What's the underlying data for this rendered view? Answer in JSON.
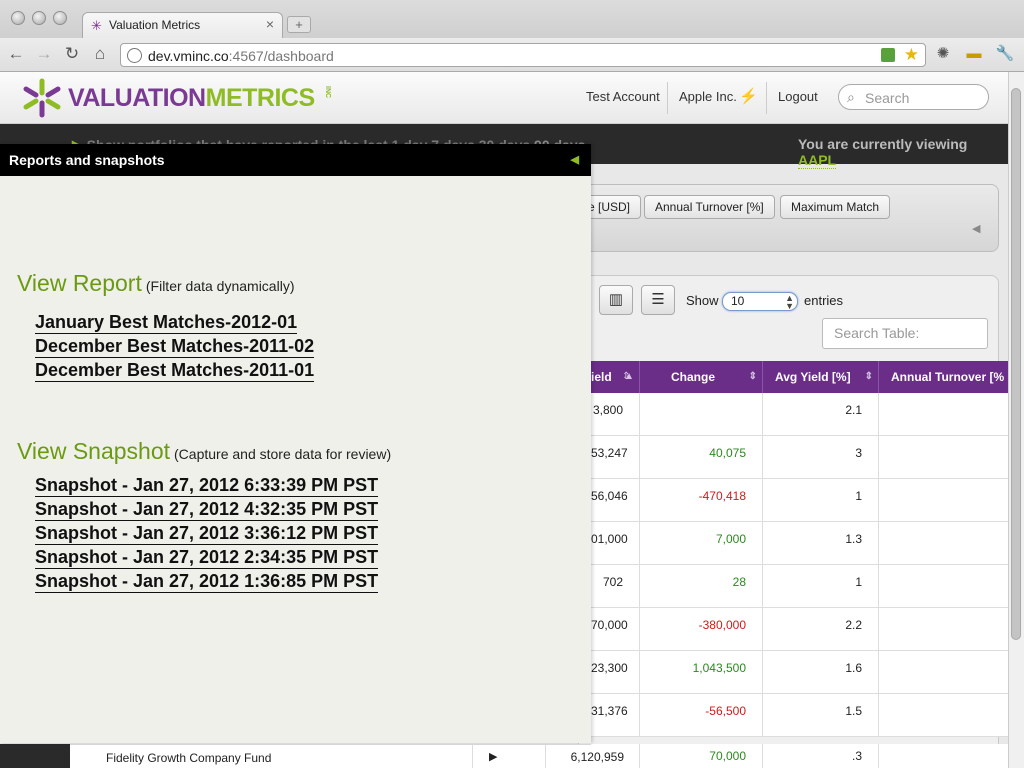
{
  "browser": {
    "tab_title": "Valuation Metrics",
    "url_host": "dev.vminc.co",
    "url_rest": ":4567/dashboard",
    "new_tab": "+",
    "close_tab": "×"
  },
  "header": {
    "logo_valuation": "VALUATION",
    "logo_metrics": "METRICS",
    "logo_inc": "INC",
    "nav": [
      "Test Account",
      "Apple Inc.",
      "Logout"
    ],
    "search_placeholder": "Search"
  },
  "filter_bar": {
    "prefix": "Show portfolios that have reported in the last",
    "options": [
      "1 day",
      "7 days",
      "30 days",
      "90 days"
    ],
    "viewing_text": "You are currently viewing",
    "ticker": "AAPL"
  },
  "columns_filter": {
    "pills": [
      "e [USD]",
      "Annual Turnover [%]",
      "Maximum Match"
    ]
  },
  "table_controls": {
    "show_label": "Show",
    "show_value": "10",
    "entries_label": "entries",
    "search_placeholder": "Search Table:"
  },
  "table": {
    "headers": [
      "ield",
      "Change",
      "Avg Yield [%]",
      "Annual Turnover [%"
    ],
    "rows": [
      {
        "yield": "3,800",
        "change": "",
        "avg": "2.1",
        "turnover": ""
      },
      {
        "yield": "53,247",
        "change": "40,075",
        "avg": "3",
        "turnover": ""
      },
      {
        "yield": "56,046",
        "change": "-470,418",
        "avg": "1",
        "turnover": ""
      },
      {
        "yield": "01,000",
        "change": "7,000",
        "avg": "1.3",
        "turnover": ""
      },
      {
        "yield": "702",
        "change": "28",
        "avg": "1",
        "turnover": ""
      },
      {
        "yield": "70,000",
        "change": "-380,000",
        "avg": "2.2",
        "turnover": ""
      },
      {
        "yield": "23,300",
        "change": "1,043,500",
        "avg": "1.6",
        "turnover": ""
      },
      {
        "yield": "31,376",
        "change": "-56,500",
        "avg": "1.5",
        "turnover": ""
      }
    ],
    "last_row": {
      "name": "Fidelity Growth Company Fund",
      "arrow": "▶",
      "yield": "6,120,959",
      "change": "70,000",
      "avg": ".3"
    }
  },
  "panel": {
    "title": "Reports and snapshots",
    "report_title": "View Report",
    "report_sub": "(Filter data dynamically)",
    "reports": [
      "January Best Matches-2012-01",
      "December Best Matches-2011-02",
      "December Best Matches-2011-01"
    ],
    "snapshot_title": "View Snapshot",
    "snapshot_sub": "(Capture and store data for review)",
    "snapshots": [
      "Snapshot - Jan 27, 2012 6:33:39 PM PST",
      "Snapshot - Jan 27, 2012 4:32:35 PM PST",
      "Snapshot - Jan 27, 2012 3:36:12 PM PST",
      "Snapshot - Jan 27, 2012 2:34:35 PM PST",
      "Snapshot - Jan 27, 2012 1:36:85 PM PST"
    ]
  },
  "colors": {
    "brand_purple": "#7a3a93",
    "brand_green": "#8fbc25",
    "positive": "#2a8a1d",
    "negative": "#d11a1a"
  }
}
